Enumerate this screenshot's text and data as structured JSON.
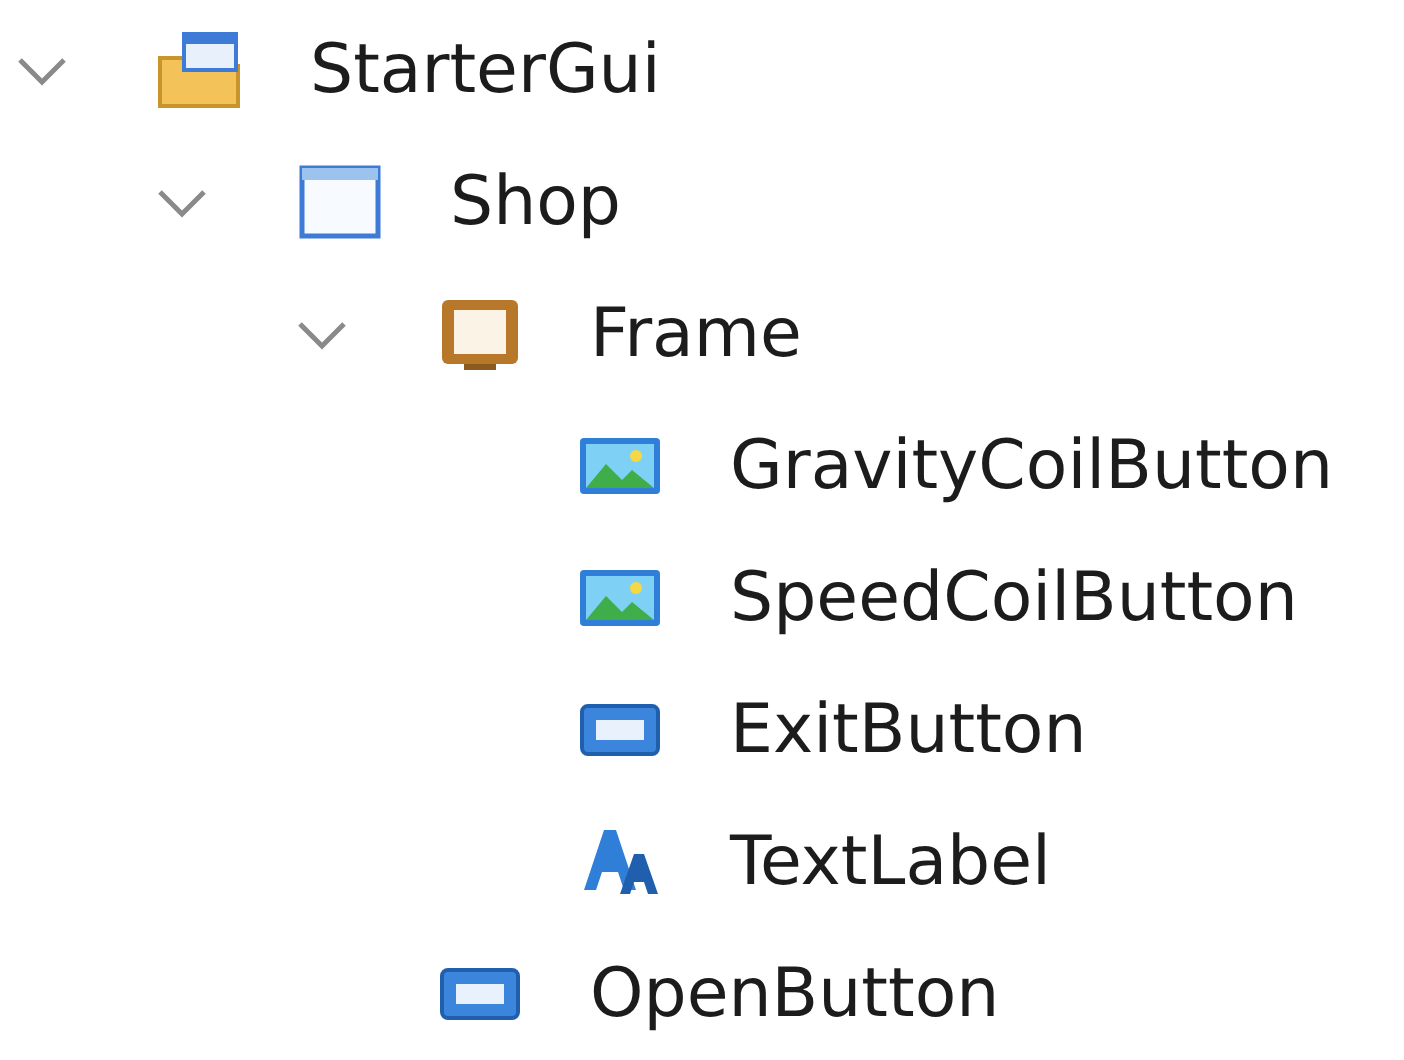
{
  "explorer": {
    "items": [
      {
        "label": "StarterGui",
        "kind": "gui-folder",
        "expanded": true,
        "children": [
          {
            "label": "Shop",
            "kind": "screen",
            "expanded": true,
            "children": [
              {
                "label": "Frame",
                "kind": "frame",
                "expanded": true,
                "children": [
                  {
                    "label": "GravityCoilButton",
                    "kind": "image-button"
                  },
                  {
                    "label": "SpeedCoilButton",
                    "kind": "image-button"
                  },
                  {
                    "label": "ExitButton",
                    "kind": "text-button"
                  },
                  {
                    "label": "TextLabel",
                    "kind": "text-label"
                  }
                ]
              },
              {
                "label": "OpenButton",
                "kind": "text-button"
              }
            ]
          }
        ]
      }
    ]
  }
}
